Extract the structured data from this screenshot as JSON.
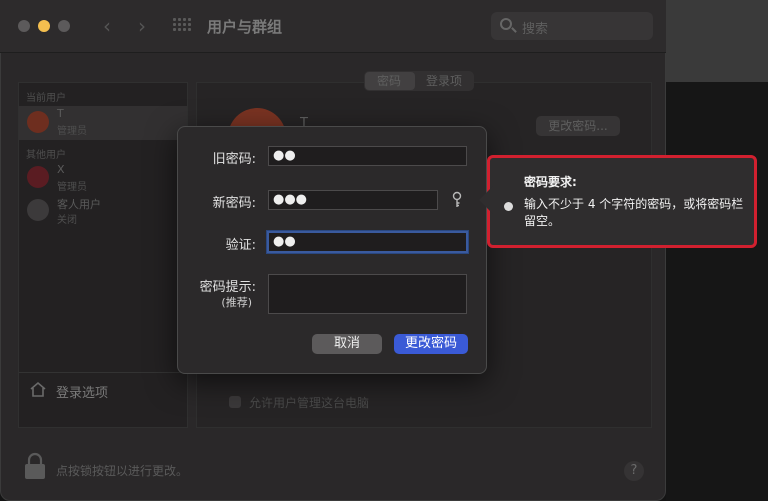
{
  "window": {
    "title": "用户与群组",
    "search_placeholder": "搜索"
  },
  "sidebar": {
    "current_users_label": "当前用户",
    "current_user": {
      "name": "T",
      "role": "管理员"
    },
    "other_users_label": "其他用户",
    "other_users": [
      {
        "name": "X",
        "role": "管理员"
      },
      {
        "name": "客人用户",
        "role": "关闭"
      }
    ],
    "login_options": "登录选项"
  },
  "main": {
    "tabs": [
      "密码",
      "登录项"
    ],
    "change_password_button": "更改密码...",
    "user_name_partial": "T",
    "checkbox_label": "允许用户管理这台电脑"
  },
  "footer": {
    "lock_text": "点按锁按钮以进行更改。",
    "help": "?"
  },
  "dialog": {
    "old_password_label": "旧密码:",
    "old_password_value": "●●",
    "new_password_label": "新密码:",
    "new_password_value": "●●●",
    "verify_label": "验证:",
    "verify_value": "●●",
    "hint_label": "密码提示:",
    "hint_sub": "(推荐)",
    "cancel": "取消",
    "confirm": "更改密码"
  },
  "tooltip": {
    "title": "密码要求:",
    "body": "输入不少于 4 个字符的密码，或将密码栏留空。"
  },
  "colors": {
    "accent": "#3a5ad6",
    "highlight_border": "#d1202f",
    "traffic_yellow": "#f4bf4f"
  }
}
